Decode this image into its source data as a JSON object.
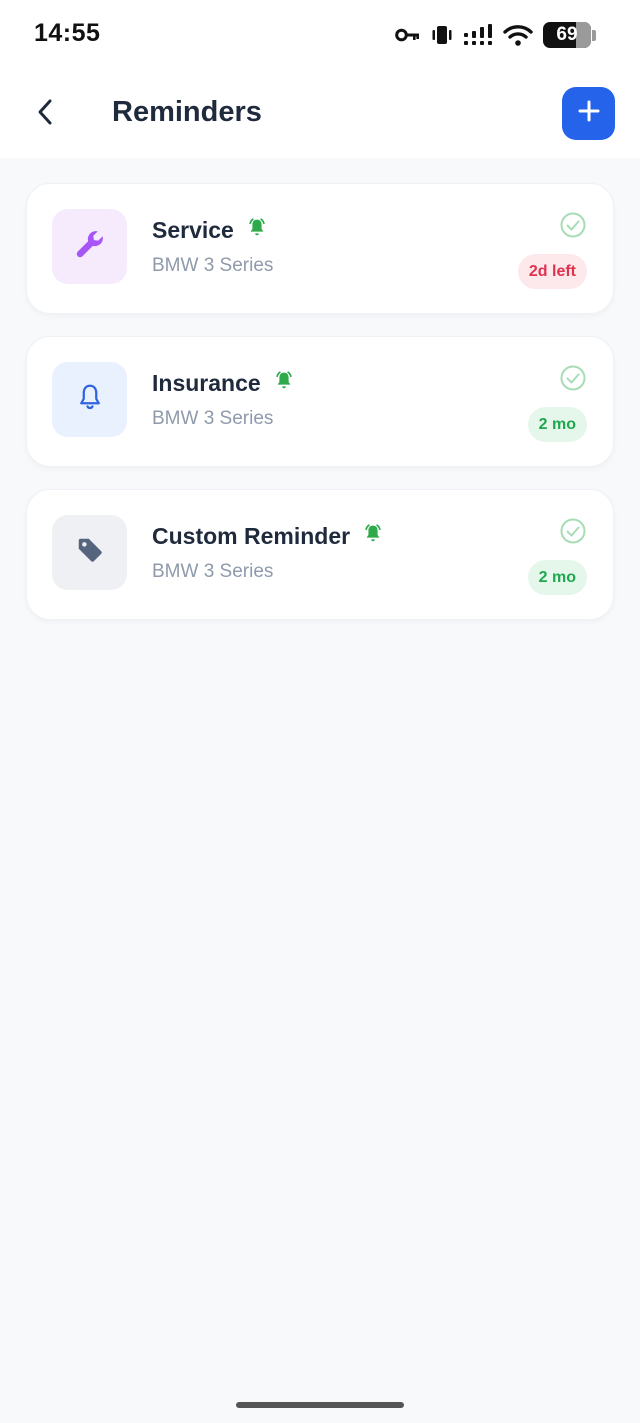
{
  "status_bar": {
    "time": "14:55",
    "battery_level": "69",
    "battery_fraction": 0.69,
    "icons": [
      "key-icon",
      "vibrate-icon",
      "signal-icon",
      "wifi-icon",
      "battery-icon"
    ]
  },
  "header": {
    "title": "Reminders",
    "back_icon": "chevron-left-icon",
    "add_icon": "plus-icon"
  },
  "colors": {
    "accent": "#2563eb",
    "alarm_green": "#2eaa4a",
    "check_green": "#a8dcb5",
    "urgent_text": "#e0324f",
    "urgent_bg": "#fde8ec",
    "ok_text": "#1fa750",
    "ok_bg": "#e5f7ea"
  },
  "reminders": [
    {
      "title": "Service",
      "vehicle": "BMW 3 Series",
      "badge": "2d left",
      "status": "urgent",
      "icon": "wrench-icon",
      "icon_bg": "#f5ebfd",
      "icon_color": "#a855f7"
    },
    {
      "title": "Insurance",
      "vehicle": "BMW 3 Series",
      "badge": "2 mo",
      "status": "ok",
      "icon": "bell-icon",
      "icon_bg": "#e9f0fe",
      "icon_color": "#2f64e0"
    },
    {
      "title": "Custom Reminder",
      "vehicle": "BMW 3 Series",
      "badge": "2 mo",
      "status": "ok",
      "icon": "tag-icon",
      "icon_bg": "#eef0f3",
      "icon_color": "#56657e"
    }
  ]
}
